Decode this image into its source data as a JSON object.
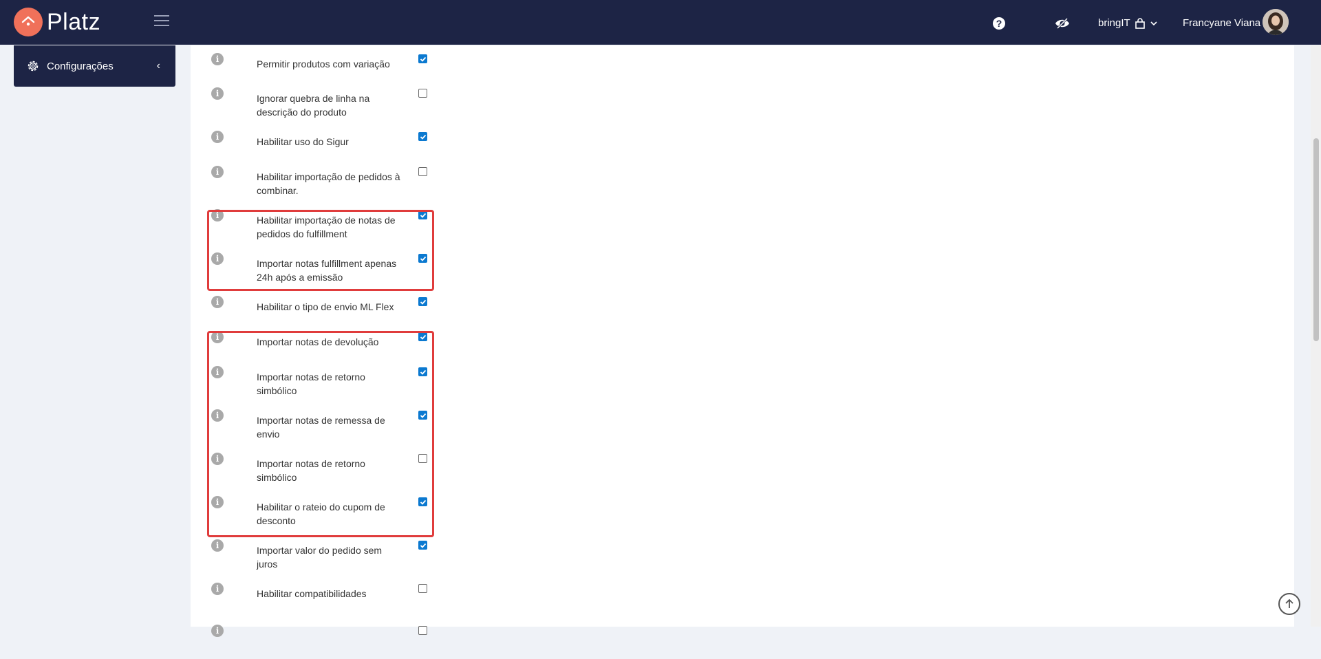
{
  "app": {
    "name": "Platz"
  },
  "header": {
    "company": "bringIT",
    "user": "Francyane Viana"
  },
  "sidebar": {
    "item_label": "Configurações"
  },
  "settings": [
    {
      "label": "Permitir produtos com variação",
      "checked": true
    },
    {
      "label": "Ignorar quebra de linha na descrição do produto",
      "checked": false
    },
    {
      "label": "Habilitar uso do Sigur",
      "checked": true
    },
    {
      "label": "Habilitar importação de pedidos à combinar.",
      "checked": false
    },
    {
      "label": "Habilitar importação de notas de pedidos do fulfillment",
      "checked": true
    },
    {
      "label": "Importar notas fulfillment apenas 24h após a emissão",
      "checked": true
    },
    {
      "label": "Habilitar o tipo de envio ML Flex",
      "checked": true
    },
    {
      "label": "Importar notas de devolução",
      "checked": true
    },
    {
      "label": "Importar notas de retorno simbólico",
      "checked": true
    },
    {
      "label": "Importar notas de remessa de envio",
      "checked": true
    },
    {
      "label": "Importar notas de retorno simbólico",
      "checked": false
    },
    {
      "label": "Habilitar o rateio do cupom de desconto",
      "checked": true
    },
    {
      "label": "Importar valor do pedido sem juros",
      "checked": true
    },
    {
      "label": "Habilitar compatibilidades",
      "checked": false
    },
    {
      "label": "",
      "checked": false
    }
  ],
  "colors": {
    "nav": "#1d2445",
    "accent": "#f0715a",
    "checkbox": "#0b79d0",
    "highlight": "#e03c3c"
  }
}
